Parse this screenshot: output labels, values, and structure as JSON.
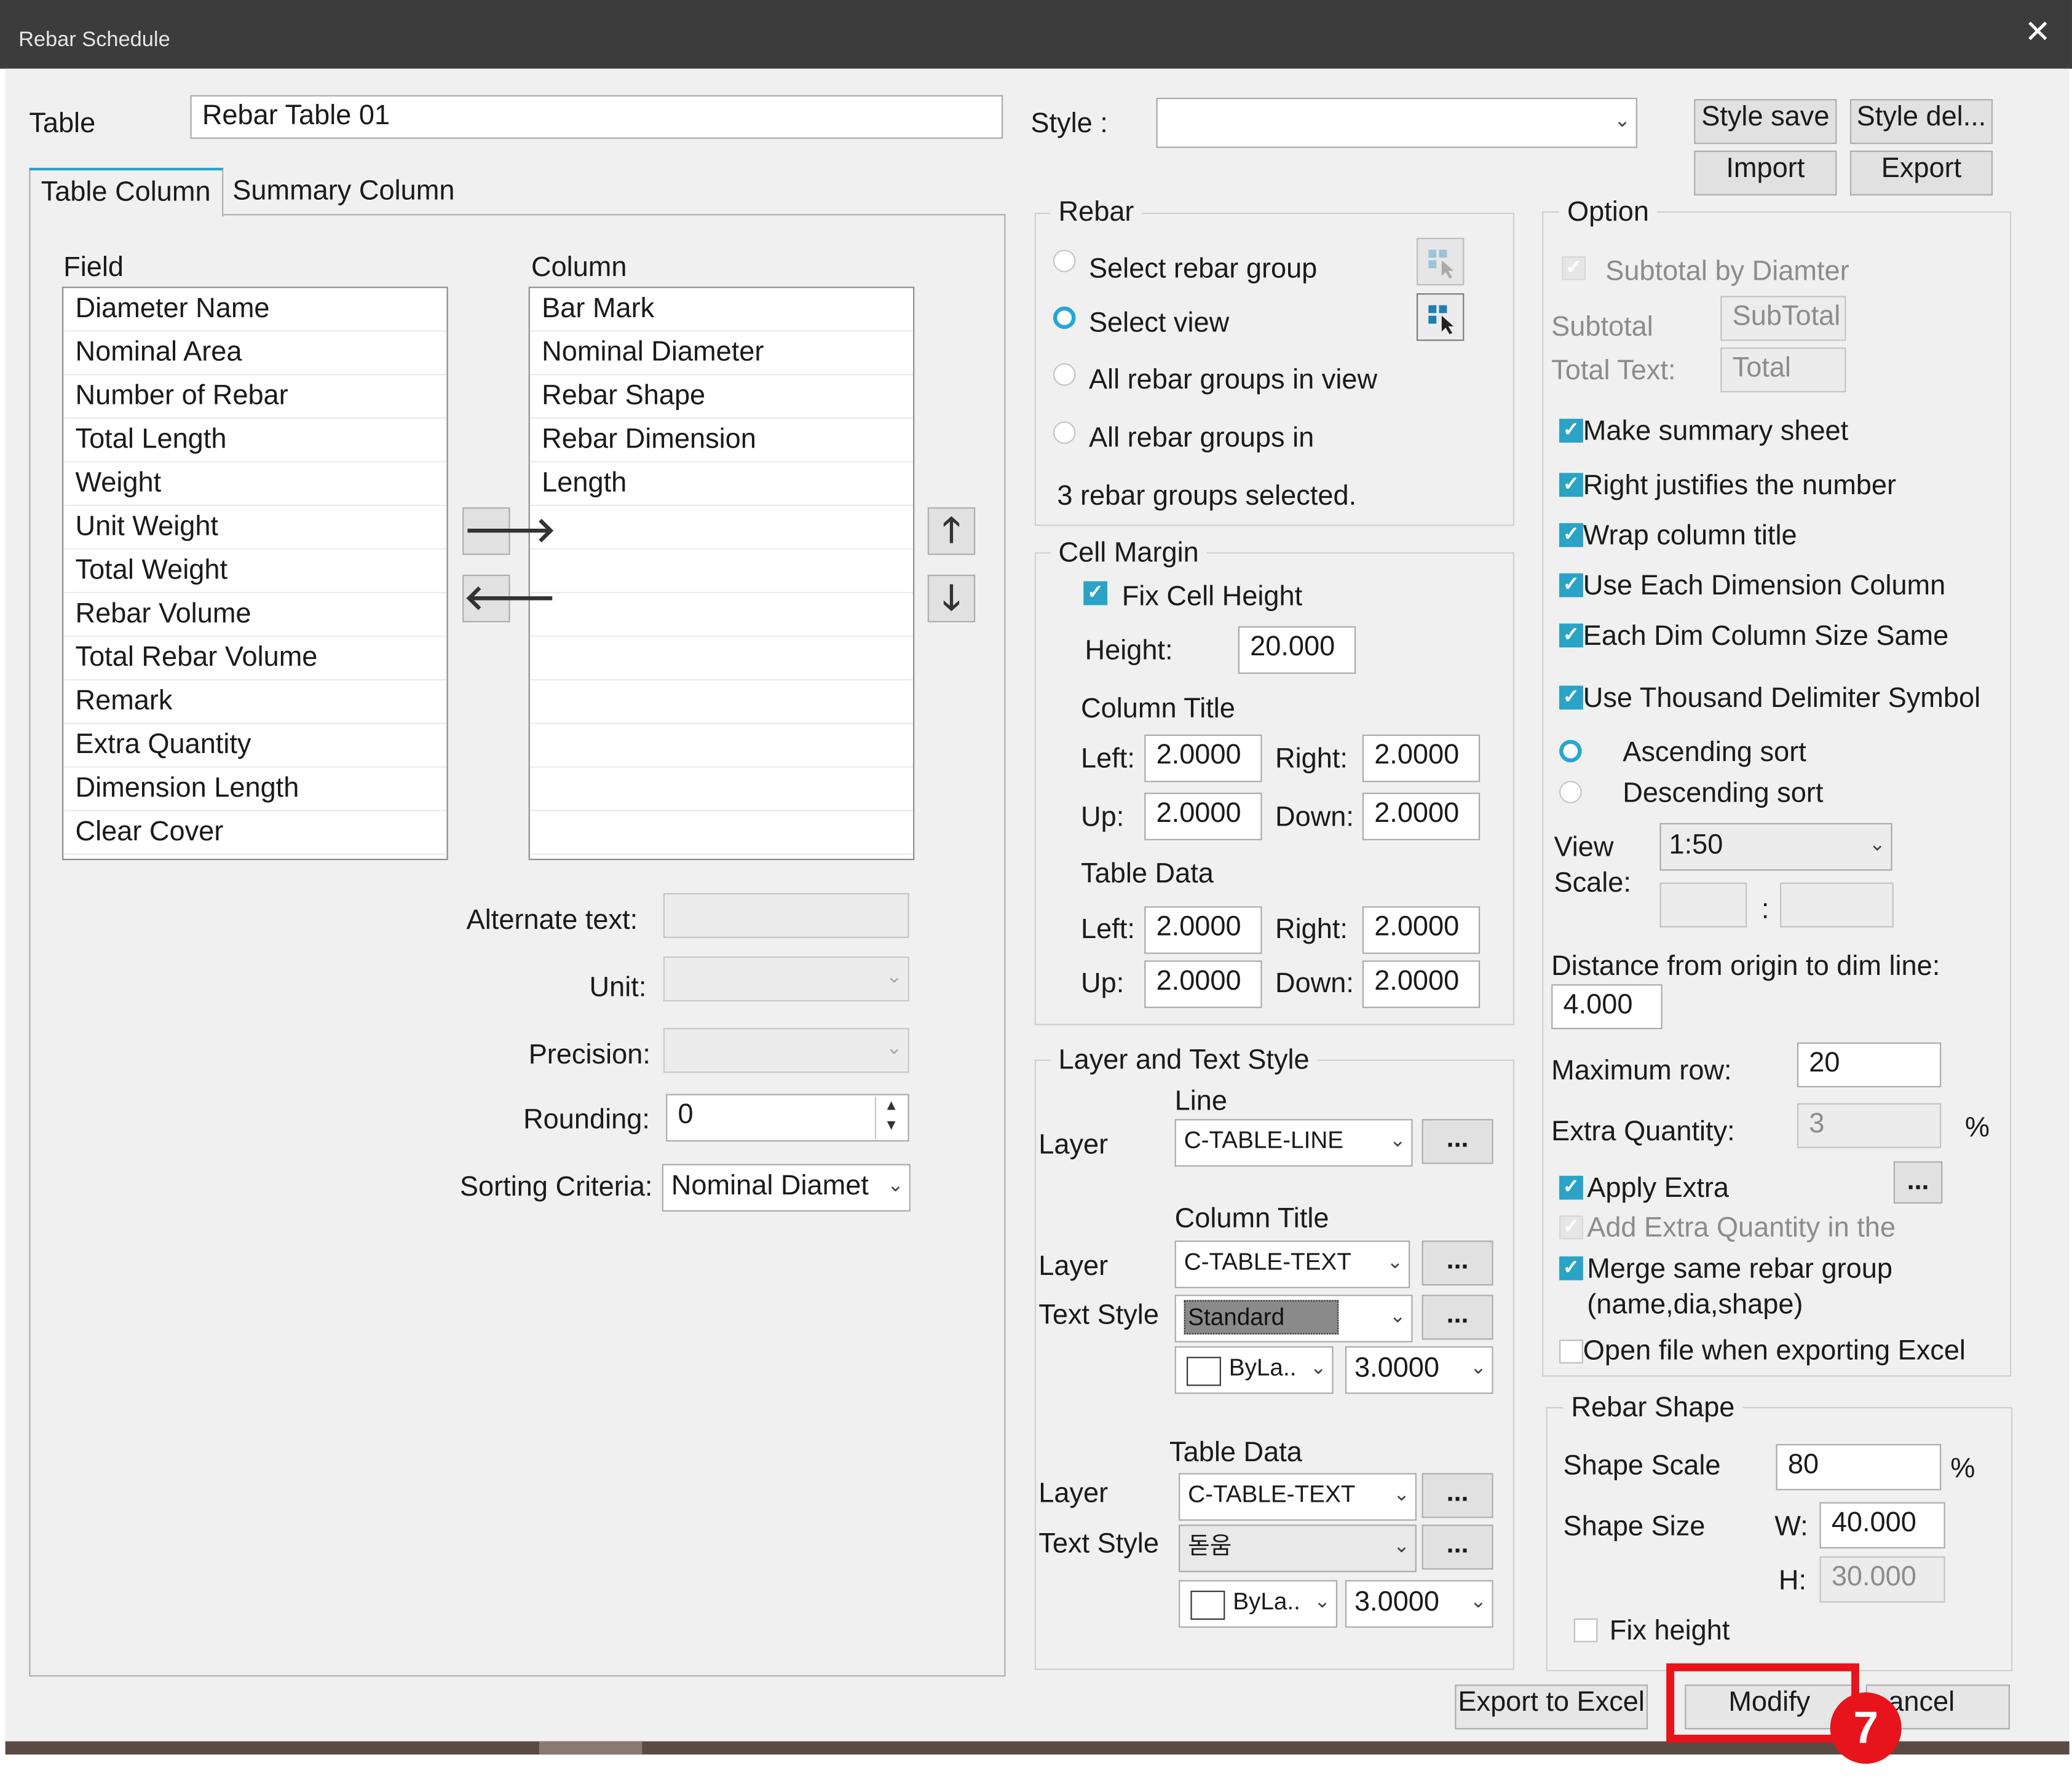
{
  "window": {
    "title": "Rebar Schedule",
    "close_glyph": "✕"
  },
  "header": {
    "table_label": "Table",
    "table_name": "Rebar Table 01",
    "style_label": "Style :",
    "style_value": "",
    "style_save": "Style save",
    "style_delete": "Style del...",
    "import": "Import",
    "export": "Export"
  },
  "tabs": {
    "table_column": "Table Column",
    "summary_column": "Summary Column"
  },
  "field_panel": {
    "field_label": "Field",
    "column_label": "Column",
    "fields": [
      "Diameter Name",
      "Nominal Area",
      "Number of Rebar",
      "Total Length",
      "Weight",
      "Unit Weight",
      "Total Weight",
      "Rebar Volume",
      "Total Rebar Volume",
      "Remark",
      "Extra Quantity",
      "Dimension Length",
      "Clear Cover"
    ],
    "columns": [
      "Bar Mark",
      "Nominal Diameter",
      "Rebar Shape",
      "Rebar Dimension",
      "Length"
    ],
    "alternate_text_label": "Alternate text:",
    "alternate_text_value": "",
    "unit_label": "Unit:",
    "unit_value": "",
    "precision_label": "Precision:",
    "precision_value": "",
    "rounding_label": "Rounding:",
    "rounding_value": "0",
    "sorting_label": "Sorting Criteria:",
    "sorting_value": "Nominal Diamet"
  },
  "rebar": {
    "title": "Rebar",
    "options": [
      "Select rebar group",
      "Select view",
      "All rebar groups in view",
      "All rebar groups in"
    ],
    "selected_option": "Select view",
    "status": "3 rebar groups selected."
  },
  "cell_margin": {
    "title": "Cell Margin",
    "fix_cell_height_label": "Fix Cell Height",
    "fix_cell_height": true,
    "height_label": "Height:",
    "height_value": "20.000",
    "column_title_label": "Column Title",
    "table_data_label": "Table Data",
    "left_label": "Left:",
    "right_label": "Right:",
    "up_label": "Up:",
    "down_label": "Down:",
    "ct_left": "2.0000",
    "ct_right": "2.0000",
    "ct_up": "2.0000",
    "ct_down": "2.0000",
    "td_left": "2.0000",
    "td_right": "2.0000",
    "td_up": "2.0000",
    "td_down": "2.0000"
  },
  "layer_text": {
    "title": "Layer and Text Style",
    "line_label": "Line",
    "column_title_label": "Column Title",
    "table_data_label": "Table Data",
    "layer_label": "Layer",
    "text_style_label": "Text Style",
    "line_layer": "C-TABLE-LINE",
    "ct_layer": "C-TABLE-TEXT",
    "ct_text_style": "Standard",
    "ct_color": "ByLa..",
    "ct_height": "3.0000",
    "td_layer": "C-TABLE-TEXT",
    "td_text_style": "돋움",
    "td_color": "ByLa..",
    "td_height": "3.0000",
    "more": "..."
  },
  "option": {
    "title": "Option",
    "subtotal_by_diameter": "Subtotal by Diamter",
    "subtotal_label": "Subtotal",
    "subtotal_value": "SubTotal",
    "total_text_label": "Total Text:",
    "total_text_value": "Total",
    "make_summary_sheet": "Make summary sheet",
    "right_justifies": "Right justifies the number",
    "wrap_column_title": "Wrap column title",
    "use_each_dimension": "Use Each Dimension Column",
    "each_dim_same": "Each Dim Column Size Same",
    "use_thousand": "Use Thousand Delimiter Symbol",
    "ascending": "Ascending sort",
    "descending": "Descending sort",
    "sort_selected": "Ascending sort",
    "view_label": "View",
    "scale_label": "Scale:",
    "scale_value": "1:50",
    "scale_colon": ":",
    "distance_label": "Distance from origin to dim line:",
    "distance_value": "4.000",
    "max_row_label": "Maximum row:",
    "max_row_value": "20",
    "extra_qty_label": "Extra Quantity:",
    "extra_qty_value": "3",
    "percent": "%",
    "apply_extra": "Apply Extra",
    "add_extra_qty": "Add Extra Quantity in the",
    "merge_same": "Merge same rebar group",
    "merge_same_2": "(name,dia,shape)",
    "open_file": "Open file when exporting Excel",
    "more": "..."
  },
  "rebar_shape": {
    "title": "Rebar Shape",
    "shape_scale_label": "Shape Scale",
    "shape_scale_value": "80",
    "percent": "%",
    "shape_size_label": "Shape Size",
    "w_label": "W:",
    "w_value": "40.000",
    "h_label": "H:",
    "h_value": "30.000",
    "fix_height_label": "Fix height"
  },
  "footer": {
    "export_excel": "Export to Excel",
    "modify": "Modify",
    "cancel": "ancel",
    "step_badge": "7"
  },
  "colors": {
    "accent": "#2aa3c7",
    "highlight": "#e8141c",
    "titlebar": "#3c3c3c",
    "dialog_bg": "#f0f0f0"
  }
}
